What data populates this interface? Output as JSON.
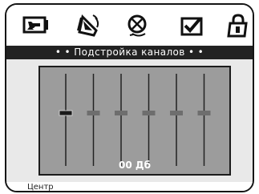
{
  "menu": {
    "items": [
      {
        "icon": "picture-icon",
        "selected": false
      },
      {
        "icon": "speaker-icon",
        "selected": true
      },
      {
        "icon": "satellite-dish-icon",
        "selected": false
      },
      {
        "icon": "checkbox-icon",
        "selected": false
      },
      {
        "icon": "lock-icon",
        "selected": false
      }
    ]
  },
  "panel": {
    "title": "• • Подстройка каналов • •"
  },
  "equalizer": {
    "channel_count": 6,
    "selected_channel": 1,
    "levels_db": [
      0,
      0,
      0,
      0,
      0,
      0
    ],
    "readout": "00 Дб"
  },
  "status": {
    "text": "Центр"
  },
  "colors": {
    "background": "#e9e9e9",
    "title_bar": "#222222",
    "panel": "#9c9c9c",
    "selected_handle": "#1a1a1a",
    "handle": "#6e6e6e"
  }
}
